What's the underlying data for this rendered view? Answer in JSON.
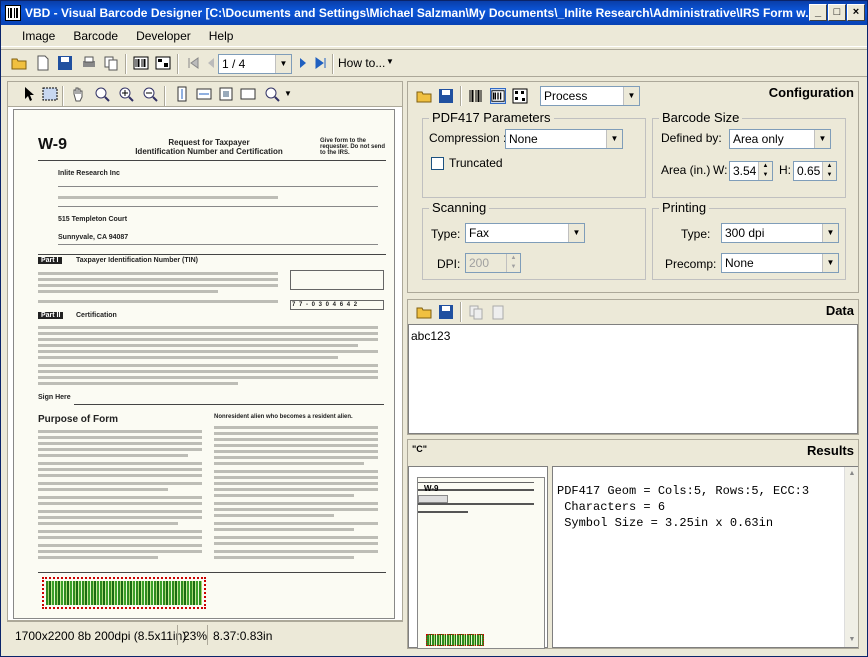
{
  "window": {
    "title": "VBD - Visual Barcode Designer [C:\\Documents and Settings\\Michael Salzman\\My Documents\\_Inlite Research\\Administrative\\IRS Form w..."
  },
  "menu": [
    "Image",
    "Barcode",
    "Developer",
    "Help"
  ],
  "toolbar": {
    "page": "1 / 4",
    "howto": "How to..."
  },
  "config": {
    "title": "Configuration",
    "mode": "Process",
    "pdf417": {
      "label": "PDF417 Parameters",
      "compression_label": "Compression :",
      "compression": "None",
      "truncated": "Truncated"
    },
    "size": {
      "label": "Barcode Size",
      "defined_label": "Defined by:",
      "defined": "Area only",
      "area_label": "Area (in.)",
      "w_label": "W:",
      "w": "3.54",
      "h_label": "H:",
      "h": "0.65"
    },
    "scanning": {
      "label": "Scanning",
      "type_label": "Type:",
      "type": "Fax",
      "dpi_label": "DPI:",
      "dpi": "200"
    },
    "printing": {
      "label": "Printing",
      "type_label": "Type:",
      "type": "300 dpi",
      "precomp_label": "Precomp:",
      "precomp": "None"
    }
  },
  "data_panel": {
    "title": "Data",
    "text": "abc123"
  },
  "results": {
    "title": "Results",
    "lines": [
      "PDF417 Geom = Cols:5, Rows:5, ECC:3",
      " Characters = 6",
      " Symbol Size = 3.25in x 0.63in"
    ]
  },
  "document": {
    "form": "W-9",
    "heading1": "Request for Taxpayer",
    "heading2": "Identification Number and Certification",
    "give": "Give form to the requester. Do not send to the IRS.",
    "name": "Inlite Research Inc",
    "address": "515 Templeton Court",
    "city": "Sunnyvale, CA 94087",
    "part1": "Part I",
    "part1_title": "Taxpayer Identification Number (TIN)",
    "ein": "7 7 - 0 3 0 4 6 4 2",
    "part2": "Part II",
    "part2_title": "Certification",
    "sign": "Sign Here",
    "purpose": "Purpose of Form",
    "nonresident": "Nonresident alien who becomes a resident alien."
  },
  "status": {
    "image": "1700x2200 8b 200dpi (8.5x11in)",
    "zoom": "23%",
    "pos": "8.37:0.83in"
  }
}
